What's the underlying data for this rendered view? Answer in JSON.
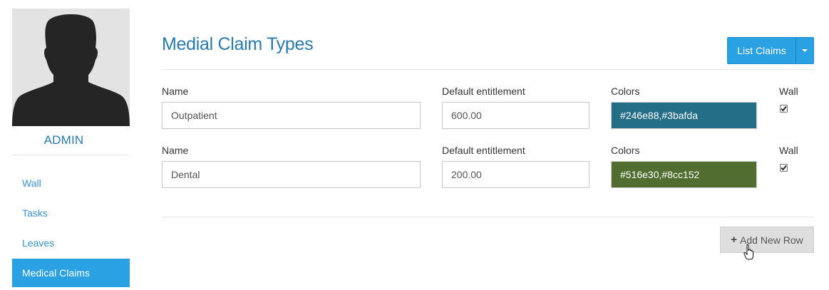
{
  "sidebar": {
    "username": "ADMIN",
    "items": [
      {
        "label": "Wall"
      },
      {
        "label": "Tasks"
      },
      {
        "label": "Leaves"
      },
      {
        "label": "Medical Claims",
        "active": true
      }
    ]
  },
  "main": {
    "title": "Medial Claim Types",
    "list_button": "List Claims",
    "add_button": "Add New Row",
    "rows": [
      {
        "name_label": "Name",
        "name": "Outpatient",
        "entitlement_label": "Default entitlement",
        "entitlement": "600.00",
        "colors_label": "Colors",
        "colors": "#246e88,#3bafda",
        "wall_label": "Wall",
        "wall": true
      },
      {
        "name_label": "Name",
        "name": "Dental",
        "entitlement_label": "Default entitlement",
        "entitlement": "200.00",
        "colors_label": "Colors",
        "colors": "#516e30,#8cc152",
        "wall_label": "Wall",
        "wall": true
      }
    ]
  },
  "colors": {
    "accent": "#2aa1e3",
    "title": "#2a7ab0",
    "row1_swatch": "#246e88",
    "row2_swatch": "#516e30"
  },
  "icons": [
    "avatar-silhouette-icon",
    "chevron-down-icon",
    "checkbox-checked-icon",
    "plus-icon",
    "hand-cursor-icon"
  ]
}
